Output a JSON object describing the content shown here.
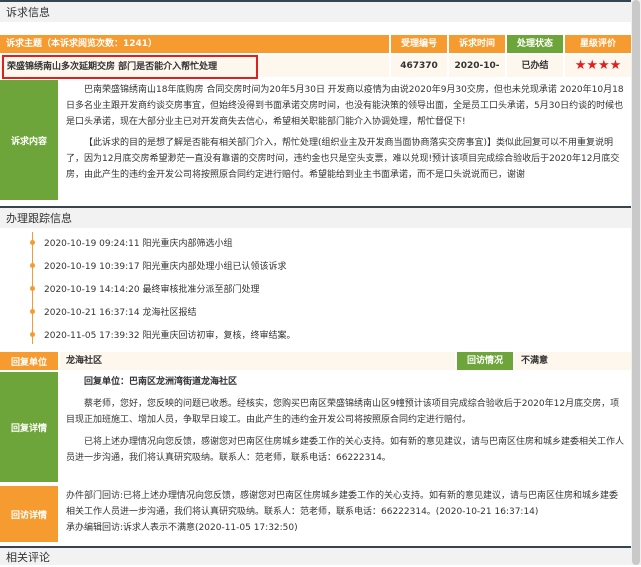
{
  "complaint": {
    "section_title": "诉求信息",
    "subject_header": "诉求主题（本诉求阅览次数：1241）",
    "columns": [
      "受理编号",
      "诉求时间",
      "处理状态",
      "星级评价"
    ],
    "subject": "荣盛锦绣南山多次延期交房 部门是否能介入帮忙处理",
    "id": "467370",
    "date": "2020-10-19",
    "status": "已办结",
    "stars": "★★★★",
    "content_label": "诉求内容",
    "content_p1": "巴南荣盛锦绣南山18年底购房 合同交房时间为20年5月30日 开发商以疫情为由说2020年9月30交房，但也未兑现承诺 2020年10月18日多名业主跟开发商约谈交房事宜，但始终没得到书面承诺交房时间，也没有能決策的领导出面，全是员工口头承诺，5月30日约谈的时候也是口头承诺，现在大部分业主已对开发商失去信心，希望相关职能部门能介入协调处理，帮忙督促下!",
    "content_p2": "【此诉求的目的是想了解是否能有相关部门介入，帮忙处理(组织业主及开发商当面协商落实交房事宜)】类似此回复可以不用重复说明了，因为12月底交房希望渺茫一直没有靠谱的交房时间，违约金也只是空头支票，难以兑现!预计该项目完成综合验收后于2020年12月底交房，由此产生的违约金开发公司将按照原合同约定进行赔付。希望能给到业主书面承诺，而不是口头说说而已，谢谢"
  },
  "tracking": {
    "section_title": "办理跟踪信息",
    "items": [
      "2020-10-19  09:24:11 阳光重庆内部筛选小组",
      "2020-10-19  10:39:17 阳光重庆内部处理小组已认领该诉求",
      "2020-10-19  14:14:20 最终审核批准分派至部门处理",
      "2020-10-21  16:37:14 龙海社区报结",
      "2020-11-05  17:39:32 阳光重庆回访初审，复核，终审结案。"
    ]
  },
  "reply": {
    "unit_label": "回复单位",
    "unit_value": "龙海社区",
    "visit_label": "回访情况",
    "visit_value": "不满意",
    "detail_label": "回复详情",
    "detail_unit": "回复单位：巴南区龙洲湾街道龙海社区",
    "detail_p1": "蔡老师，您好，您反映的问题已收悉。经核实，您购买巴南区荣盛锦绣南山区9幢预计该项目完成综合验收后于2020年12月底交房，项目现正加班施工、增加人员，争取早日竣工。由此产生的违约金开发公司将按照原合同约定进行赔付。",
    "detail_p2": "已将上述办理情况向您反馈，感谢您对巴南区住房城乡建委工作的关心支持。如有新的意见建议，请与巴南区住房和城乡建委相关工作人员进一步沟通，我们将认真研究吸纳。联系人：范老师，联系电话：66222314。",
    "visit_detail_label": "回访详情",
    "visit_detail_p1": "办件部门回访:已将上述办理情况向您反馈，感谢您对巴南区住房城乡建委工作的关心支持。如有新的意见建议，请与巴南区住房和城乡建委相关工作人员进一步沟通，我们将认真研究吸纳。联系人：范老师，联系电话：66222314。(2020-10-21 16:37:14)",
    "visit_detail_p2": "承办编辑回访:诉求人表示不满意(2020-11-05 17:32:50)"
  },
  "comments": {
    "section_title": "相关评论"
  },
  "colors": {
    "orange": "#f59b2f",
    "green": "#6ea53a",
    "subject_border": "#e02020",
    "stars": "#e02020",
    "header_border": "#36454f"
  }
}
